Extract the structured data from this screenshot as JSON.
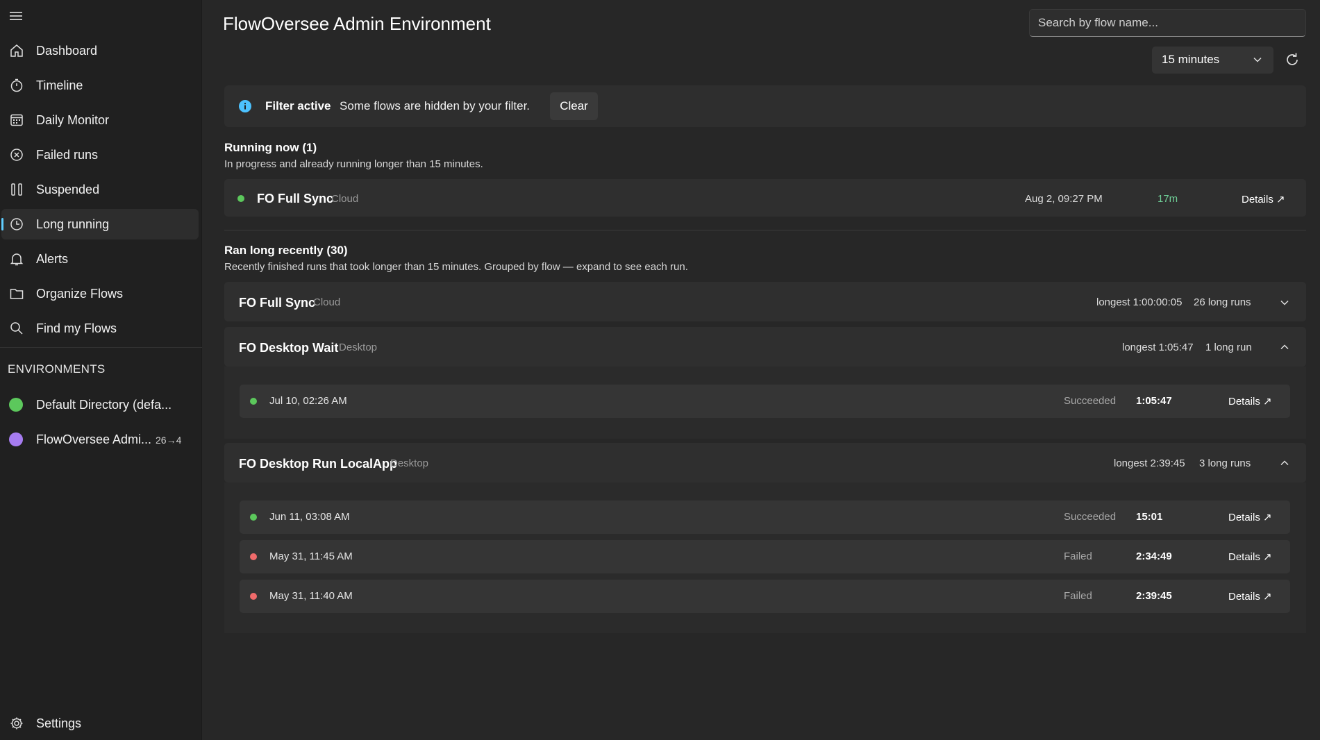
{
  "sidebar": {
    "items": [
      {
        "label": "Dashboard",
        "icon": "home-icon"
      },
      {
        "label": "Timeline",
        "icon": "stopwatch-icon"
      },
      {
        "label": "Daily Monitor",
        "icon": "calendar-icon"
      },
      {
        "label": "Failed runs",
        "icon": "error-circle-icon"
      },
      {
        "label": "Suspended",
        "icon": "pause-icon"
      },
      {
        "label": "Long running",
        "icon": "clock-icon",
        "active": true
      },
      {
        "label": "Alerts",
        "icon": "bell-icon"
      },
      {
        "label": "Organize Flows",
        "icon": "folder-icon"
      },
      {
        "label": "Find my Flows",
        "icon": "search-icon"
      }
    ],
    "environments_header": "ENVIRONMENTS",
    "environments": [
      {
        "label": "Default Directory (defa...",
        "color": "#5cc85c",
        "badge": ""
      },
      {
        "label": "FlowOversee Admi...",
        "color": "#a67cf0",
        "badge": "26→4"
      }
    ],
    "settings_label": "Settings"
  },
  "header": {
    "title": "FlowOversee Admin Environment",
    "search_placeholder": "Search by flow name...",
    "threshold": "15 minutes"
  },
  "filter": {
    "title": "Filter active",
    "message": "Some flows are hidden by your filter.",
    "clear_label": "Clear"
  },
  "running_now": {
    "title": "Running now (1)",
    "subtitle": "In progress and already running longer than 15 minutes.",
    "runs": [
      {
        "name": "FO Full Sync",
        "tag": "Cloud",
        "started": "Aug 2, 09:27 PM",
        "elapsed": "17m",
        "details": "Details ↗"
      }
    ]
  },
  "ran_long": {
    "title": "Ran long recently (30)",
    "subtitle": "Recently finished runs that took longer than 15 minutes. Grouped by flow — expand to see each run.",
    "groups": [
      {
        "name": "FO Full Sync",
        "tag": "Cloud",
        "longest": "longest 1:00:00:05",
        "count": "26 long runs",
        "expanded": false,
        "runs": []
      },
      {
        "name": "FO Desktop Wait",
        "tag": "Desktop",
        "longest": "longest 1:05:47",
        "count": "1 long run",
        "expanded": true,
        "runs": [
          {
            "when": "Jul 10, 02:26 AM",
            "status": "Succeeded",
            "duration": "1:05:47",
            "details": "Details ↗"
          }
        ]
      },
      {
        "name": "FO Desktop Run LocalApp",
        "tag": "Desktop",
        "longest": "longest 2:39:45",
        "count": "3 long runs",
        "expanded": true,
        "runs": [
          {
            "when": "Jun 11, 03:08 AM",
            "status": "Succeeded",
            "duration": "15:01",
            "details": "Details ↗"
          },
          {
            "when": "May 31, 11:45 AM",
            "status": "Failed",
            "duration": "2:34:49",
            "details": "Details ↗"
          },
          {
            "when": "May 31, 11:40 AM",
            "status": "Failed",
            "duration": "2:39:45",
            "details": "Details ↗"
          }
        ]
      }
    ]
  },
  "colors": {
    "accent": "#60cdff",
    "success": "#5cc85c",
    "failed": "#f06b6b",
    "elapsed": "#6fcf97",
    "info": "#4cc2ff"
  }
}
